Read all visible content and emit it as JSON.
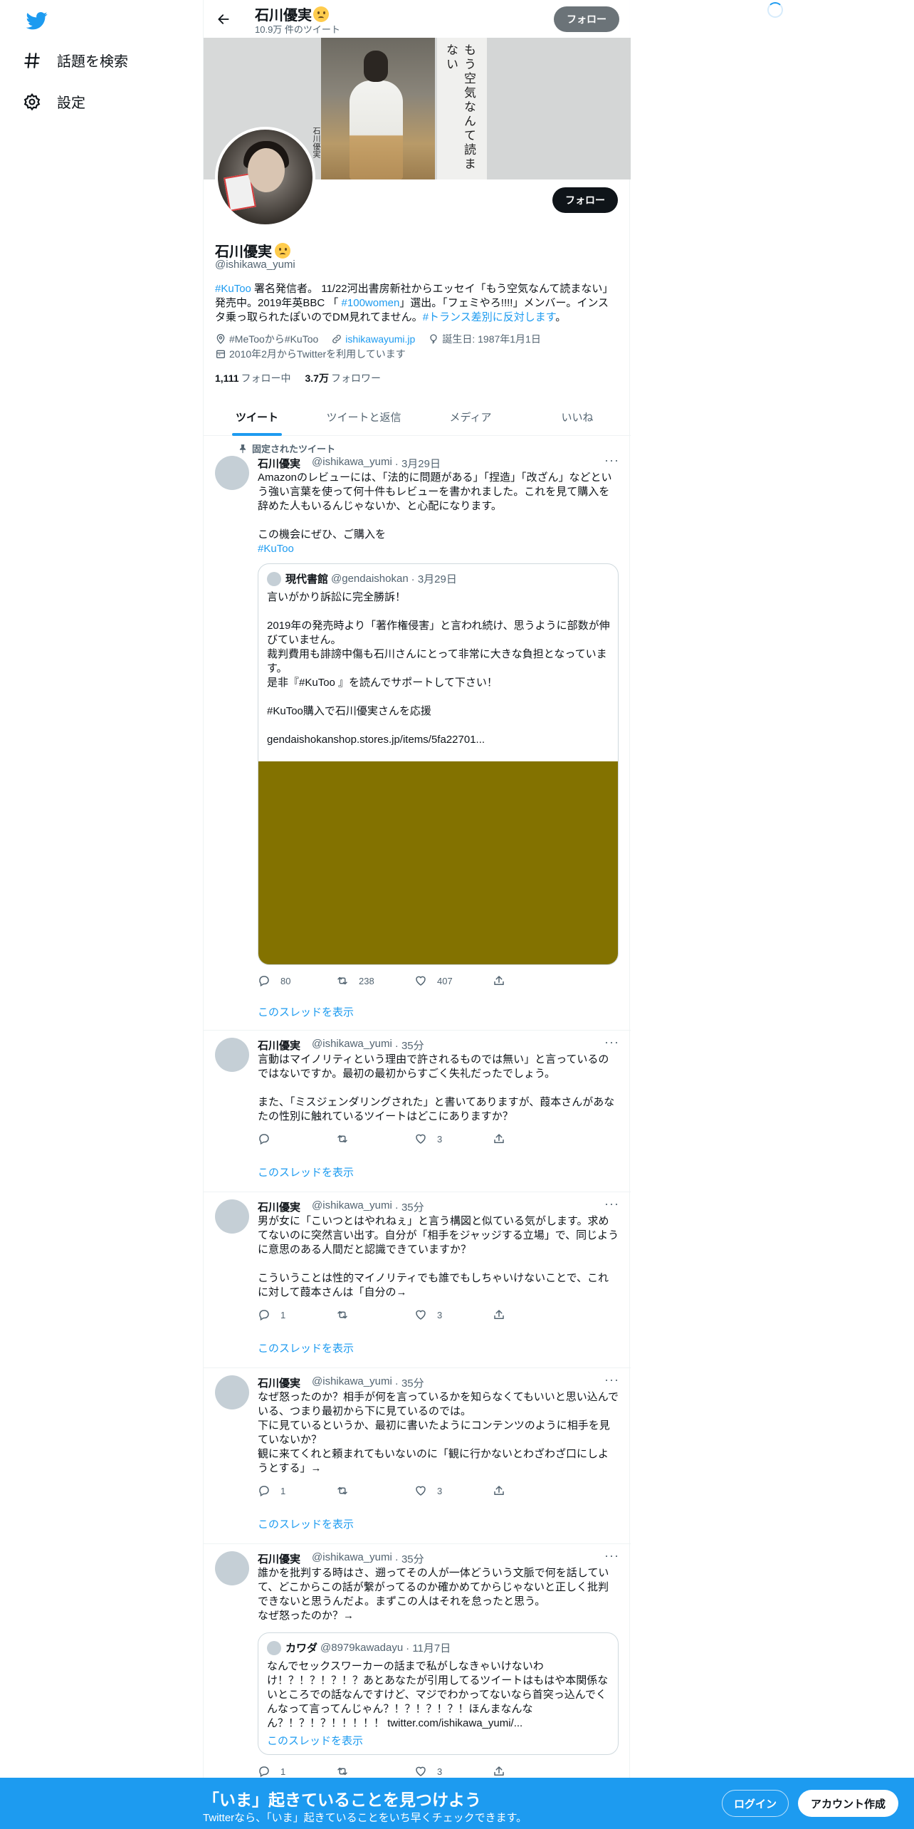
{
  "nav": {
    "logo_icon": "twitter-bird-icon",
    "explore_label": "話題を検索",
    "settings_label": "設定"
  },
  "header": {
    "name": "石川優実",
    "tweet_count": "10.9万 件のツイート",
    "follow_label": "フォロー"
  },
  "banner": {
    "vertical_text": "もう空気なんて読まない",
    "small_text": "石川優実"
  },
  "profile": {
    "follow_label": "フォロー",
    "name": "石川優実",
    "handle": "@ishikawa_yumi",
    "bio_parts": {
      "p1": "#KuToo",
      "p2": " 署名発信者。 11/22河出書房新社からエッセイ「もう空気なんて読まない」発売中。2019年英BBC 「",
      "p3": " #100women",
      "p4": "」選出。「フェミやろ!!!!」メンバー。インスタ乗っ取られたぽいのでDM見れてません。",
      "p5": "#トランス差別に反対します",
      "p6": "。"
    },
    "location": "#MeTooから#KuToo",
    "website": "ishikawayumi.jp",
    "birthday": "誕生日: 1987年1月1日",
    "joined": "2010年2月からTwitterを利用しています",
    "following_count": "1,111",
    "following_label": "フォロー中",
    "followers_count": "3.7万",
    "followers_label": "フォロワー"
  },
  "tabs": [
    "ツイート",
    "ツイートと返信",
    "メディア",
    "いいね"
  ],
  "tweets": [
    {
      "pinned_label": "固定されたツイート",
      "name": "石川優実",
      "handle": "@ishikawa_yumi",
      "time": "· 3月29日",
      "body": "Amazonのレビューには、「法的に問題がある」「捏造」「改ざん」などという強い言葉を使って何十件もレビューを書かれました。これを見て購入を辞めた人もいるんじゃないか、と心配になります。\n\nこの機会にぜひ、ご購入を",
      "hashtag": "#KuToo",
      "quote": {
        "name": "現代書館",
        "handle": "@gendaishokan",
        "time": "· 3月29日",
        "body": "言いがかり訴訟に完全勝訴！\n\n2019年の発売時より「著作権侵害」と言われ続け、思うように部数が伸びていません。\n裁判費用も誹謗中傷も石川さんにとって非常に大きな負担となっています。\n是非『#KuToo 』を読んでサポートして下さい！\n\n#KuToo購入で石川優実さんを応援\n\ngendaishokanshop.stores.jp/items/5fa22701..."
      },
      "replies": "80",
      "retweets": "238",
      "likes": "407",
      "thread_label": "このスレッドを表示"
    },
    {
      "name": "石川優実",
      "handle": "@ishikawa_yumi",
      "time": "· 35分",
      "body": "言動はマイノリティという理由で許されるものでは無い」と言っているのではないですか。最初の最初からすごく失礼だったでしょう。\n\nまた、「ミスジェンダリングされた」と書いてありますが、葭本さんがあなたの性別に触れているツイートはどこにありますか？",
      "replies": "",
      "retweets": "",
      "likes": "3",
      "thread_label": "このスレッドを表示"
    },
    {
      "name": "石川優実",
      "handle": "@ishikawa_yumi",
      "time": "· 35分",
      "body": "男が女に「こいつとはやれねぇ」と言う構図と似ている気がします。求めてないのに突然言い出す。自分が「相手をジャッジする立場」で、同じように意思のある人間だと認識できていますか？\n\nこういうことは性的マイノリティでも誰でもしちゃいけないことで、これに対して葭本さんは「自分の→",
      "replies": "1",
      "retweets": "",
      "likes": "3",
      "thread_label": "このスレッドを表示"
    },
    {
      "name": "石川優実",
      "handle": "@ishikawa_yumi",
      "time": "· 35分",
      "body": "なぜ怒ったのか？相手が何を言っているかを知らなくてもいいと思い込んでいる、つまり最初から下に見ているのでは。\n下に見ているというか、最初に書いたようにコンテンツのように相手を見ていないか？\n観に来てくれと頼まれてもいないのに「観に行かないとわざわざ口にしようとする」→",
      "replies": "1",
      "retweets": "",
      "likes": "3",
      "thread_label": "このスレッドを表示"
    },
    {
      "name": "石川優実",
      "handle": "@ishikawa_yumi",
      "time": "· 35分",
      "body": "誰かを批判する時はさ、遡ってその人が一体どういう文脈で何を話していて、どこからこの話が繋がってるのか確かめてからじゃないと正しく批判できないと思うんだよ。まずこの人はそれを怠ったと思う。\nなぜ怒ったのか？→",
      "quote": {
        "name": "カワダ",
        "handle": "@8979kawadayu",
        "time": "· 11月7日",
        "body": "なんでセックスワーカーの話まで私がしなきゃいけないわけ！？！？！？！？あとあなたが引用してるツイートはもはや本関係ないところでの話なんですけど、マジでわかってないなら首突っ込んでくんなって言ってんじゃん？！？！？！？！ほんまなんなん？！？！？！！！！！ twitter.com/ishikawa_yumi/...",
        "thread_label": "このスレッドを表示"
      },
      "replies": "1",
      "retweets": "",
      "likes": "3"
    }
  ],
  "bottom_bar": {
    "title": "「いま」起きていることを見つけよう",
    "subtitle": "Twitterなら、「いま」起きていることをいち早くチェックできます。",
    "login_label": "ログイン",
    "signup_label": "アカウント作成"
  },
  "colors": {
    "accent": "#1d9bf0",
    "media_placeholder": "#837200",
    "bottom_bar": "#1d9bf0"
  }
}
